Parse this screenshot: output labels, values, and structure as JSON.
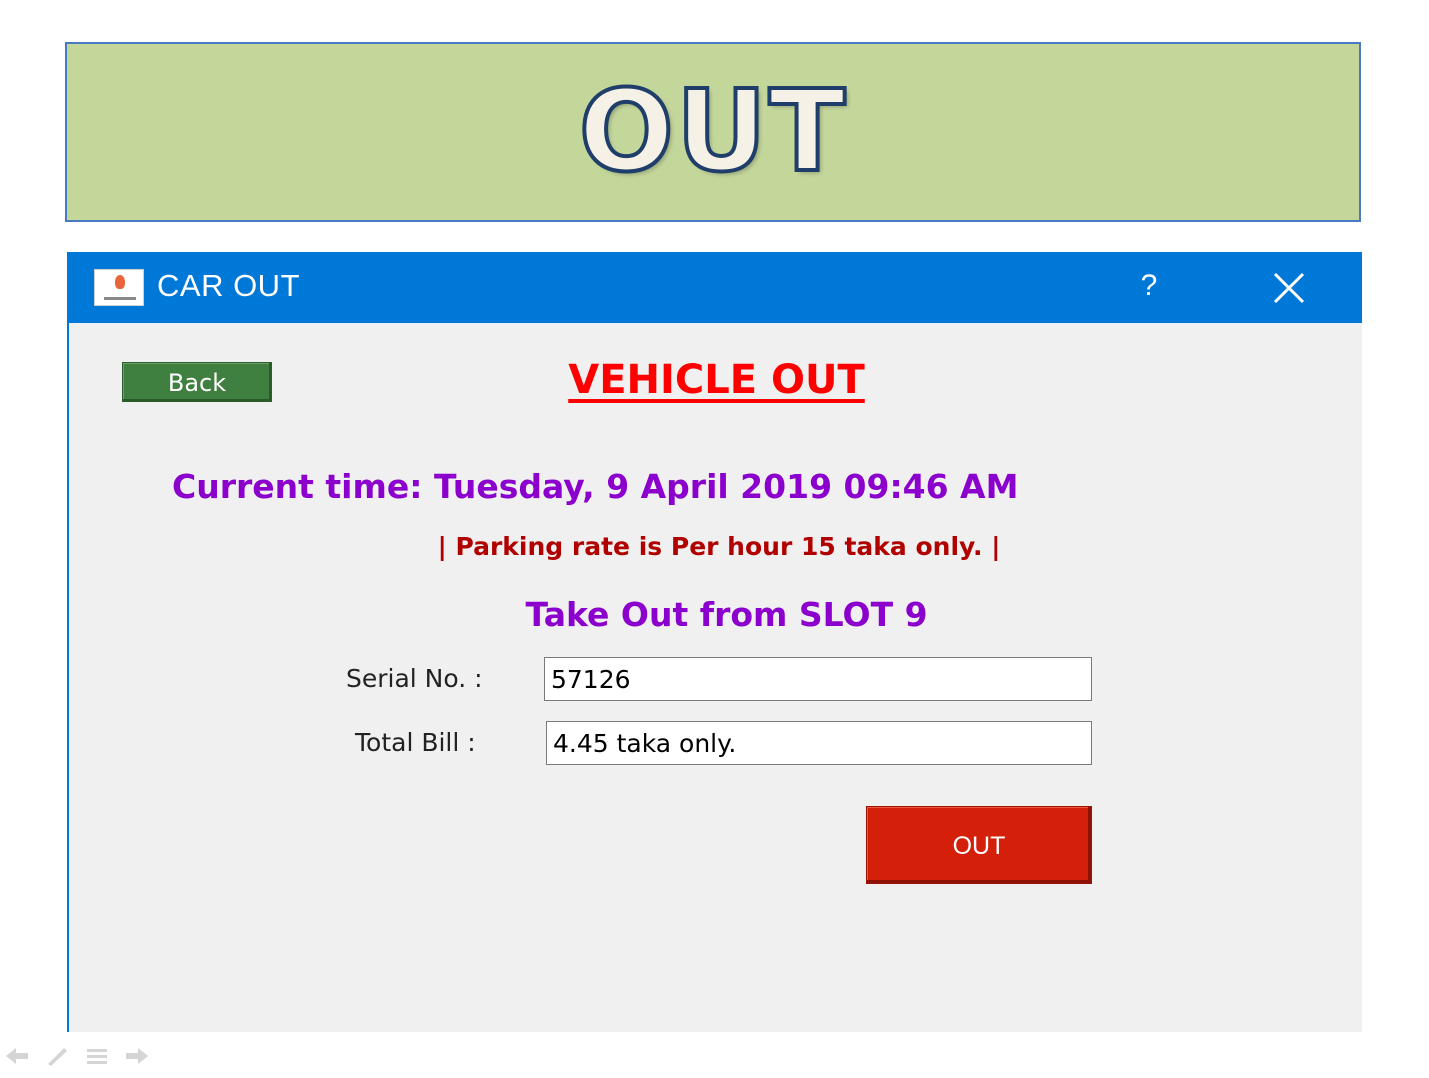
{
  "banner": {
    "title": "OUT"
  },
  "window": {
    "title": "CAR OUT",
    "help_label": "?",
    "close_icon": "close-icon",
    "app_icon": "app-logo-icon",
    "accent_color": "#0078d7"
  },
  "form": {
    "back_label": "Back",
    "heading": "VEHICLE OUT",
    "current_time": "Current time: Tuesday, 9 April 2019 09:46 AM",
    "rate_notice": "| Parking rate is Per hour 15 taka only. |",
    "slot_text": "Take Out from SLOT 9",
    "serial_label": "Serial No. :",
    "serial_value": "57126",
    "bill_label": "Total Bill :",
    "bill_value": "4.45 taka only.",
    "out_label": "OUT",
    "colors": {
      "heading": "#ff0000",
      "time": "#8b00cc",
      "rate": "#b00000",
      "back_button": "#3f7f3f",
      "out_button": "#d41f0a"
    }
  },
  "slideshow_controls": {
    "icons": [
      "previous-arrow-icon",
      "pen-icon",
      "menu-icon",
      "next-arrow-icon"
    ]
  }
}
